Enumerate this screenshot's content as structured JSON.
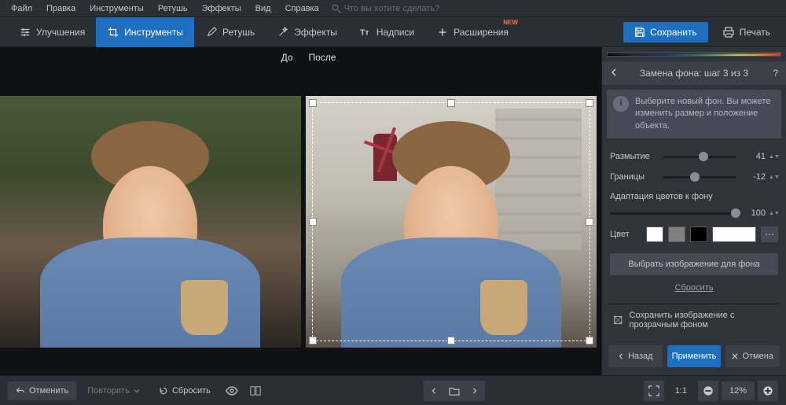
{
  "menubar": {
    "items": [
      "Файл",
      "Правка",
      "Инструменты",
      "Ретушь",
      "Эффекты",
      "Вид",
      "Справка"
    ],
    "search_placeholder": "Что вы хотите сделать?"
  },
  "toolbar": {
    "tabs": [
      {
        "label": "Улучшения",
        "icon": "sliders-icon"
      },
      {
        "label": "Инструменты",
        "icon": "crop-icon",
        "active": true
      },
      {
        "label": "Ретушь",
        "icon": "brush-icon"
      },
      {
        "label": "Эффекты",
        "icon": "wand-icon"
      },
      {
        "label": "Надписи",
        "icon": "text-icon"
      },
      {
        "label": "Расширения",
        "icon": "plus-icon",
        "badge": "NEW"
      }
    ],
    "save": "Сохранить",
    "print": "Печать"
  },
  "workspace": {
    "before": "До",
    "after": "После"
  },
  "panel": {
    "title": "Замена фона: шаг 3 из 3",
    "info": "Выберите новый фон. Вы можете изменить размер и положение объекта.",
    "blur": {
      "label": "Размытие",
      "value": 41
    },
    "border": {
      "label": "Границы",
      "value": -12
    },
    "adapt": {
      "label": "Адаптация цветов к фону",
      "value": 100
    },
    "color_label": "Цвет",
    "swatches": [
      "#ffffff",
      "#808080",
      "#000000"
    ],
    "choose_bg": "Выбрать изображение для фона",
    "reset": "Сбросить",
    "save_transparent": "Сохранить изображение с прозрачным фоном",
    "back": "Назад",
    "apply": "Применить",
    "cancel": "Отмена"
  },
  "status": {
    "undo": "Отменить",
    "redo": "Повторить",
    "reset": "Сбросить",
    "ratio": "1:1",
    "zoom": "12%"
  }
}
